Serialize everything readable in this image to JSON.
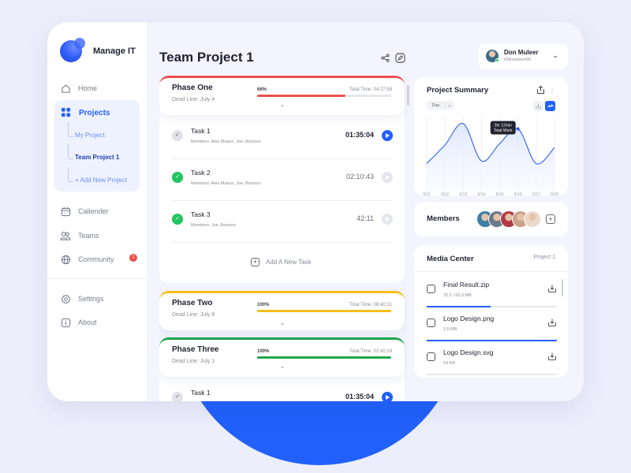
{
  "app": {
    "name": "Manage IT"
  },
  "sidebar": {
    "home": "Home",
    "projects": "Projects",
    "project_items": [
      "My Project",
      "Team Project 1",
      "+ Add New Project"
    ],
    "active_project_index": 1,
    "calendar": "Callender",
    "teams": "Teams",
    "community": "Community",
    "community_badge": "2",
    "settings": "Settings",
    "about": "About"
  },
  "header": {
    "title": "Team Project 1",
    "share_icon": "share-icon",
    "edit_icon": "edit-icon"
  },
  "user": {
    "name": "Don Muleer",
    "id": "IDNumber#00",
    "status": "online"
  },
  "phases": [
    {
      "name": "Phase One",
      "deadline": "Dead Line: July 4",
      "progress_label": "66%",
      "progress": 0.66,
      "total_time": "Total Time:  04:27:58",
      "color": "#F04E4E",
      "expanded": true,
      "tasks": [
        {
          "name": "Task 1",
          "members": "Members: Alex Mason, Joe Jhonson",
          "time": "01:35:04",
          "done": false,
          "running": true
        },
        {
          "name": "Task 2",
          "members": "Members: Alex Mason, Joe Jhonson",
          "time": "02:10:43",
          "done": true,
          "running": false
        },
        {
          "name": "Task 3",
          "members": "Members: Joe Jhonson",
          "time": "42:11",
          "done": true,
          "running": false
        }
      ],
      "add_task_label": "Add A New Task"
    },
    {
      "name": "Phase Two",
      "deadline": "Dead Line: July 8",
      "progress_label": "100%",
      "progress": 1.0,
      "total_time": "Total Time:  08:40:31",
      "color": "#F7BE1B",
      "expanded": false
    },
    {
      "name": "Phase Three",
      "deadline": "Dead Line: July 1",
      "progress_label": "100%",
      "progress": 1.0,
      "total_time": "Total Time:  02:41:19",
      "color": "#1FA54E",
      "expanded": true,
      "tasks": [
        {
          "name": "Task 1",
          "members": "",
          "time": "01:35:04",
          "done": false,
          "running": true
        }
      ]
    }
  ],
  "summary": {
    "title": "Project Summary",
    "period": "Day",
    "tooltip_line1": "2hr 12min",
    "tooltip_line2": "Total Work"
  },
  "chart_data": {
    "type": "line",
    "title": "Project Summary",
    "x": [
      "6/11",
      "6/12",
      "6/13",
      "6/14",
      "6/15",
      "6/16",
      "6/17",
      "6/18"
    ],
    "series": [
      {
        "name": "Total Work (hours)",
        "values": [
          0.9,
          1.6,
          2.4,
          1.0,
          1.65,
          2.2,
          0.9,
          1.5
        ]
      }
    ],
    "highlight": {
      "x": "6/16",
      "label": "2hr 12min Total Work"
    },
    "xlabel": "",
    "ylabel": "",
    "ylim": [
      0,
      2.6
    ],
    "grid": "vertical",
    "smooth": true,
    "area_fill": true
  },
  "members": {
    "title": "Members",
    "avatar_colors": [
      "#3F7EA6",
      "#6B7A88",
      "#B23A48",
      "#C9A38A",
      "#E9D9CC"
    ]
  },
  "media": {
    "title": "Media Center",
    "project": "Project 1",
    "files": [
      {
        "name": "Final Result.zip",
        "size": "32.2 / 65.3 MB",
        "progress": 0.49
      },
      {
        "name": "Logo Design.png",
        "size": "3.5 MB",
        "progress": 1.0
      },
      {
        "name": "Logo Design.svg",
        "size": "54 KB",
        "progress": 0
      }
    ]
  }
}
